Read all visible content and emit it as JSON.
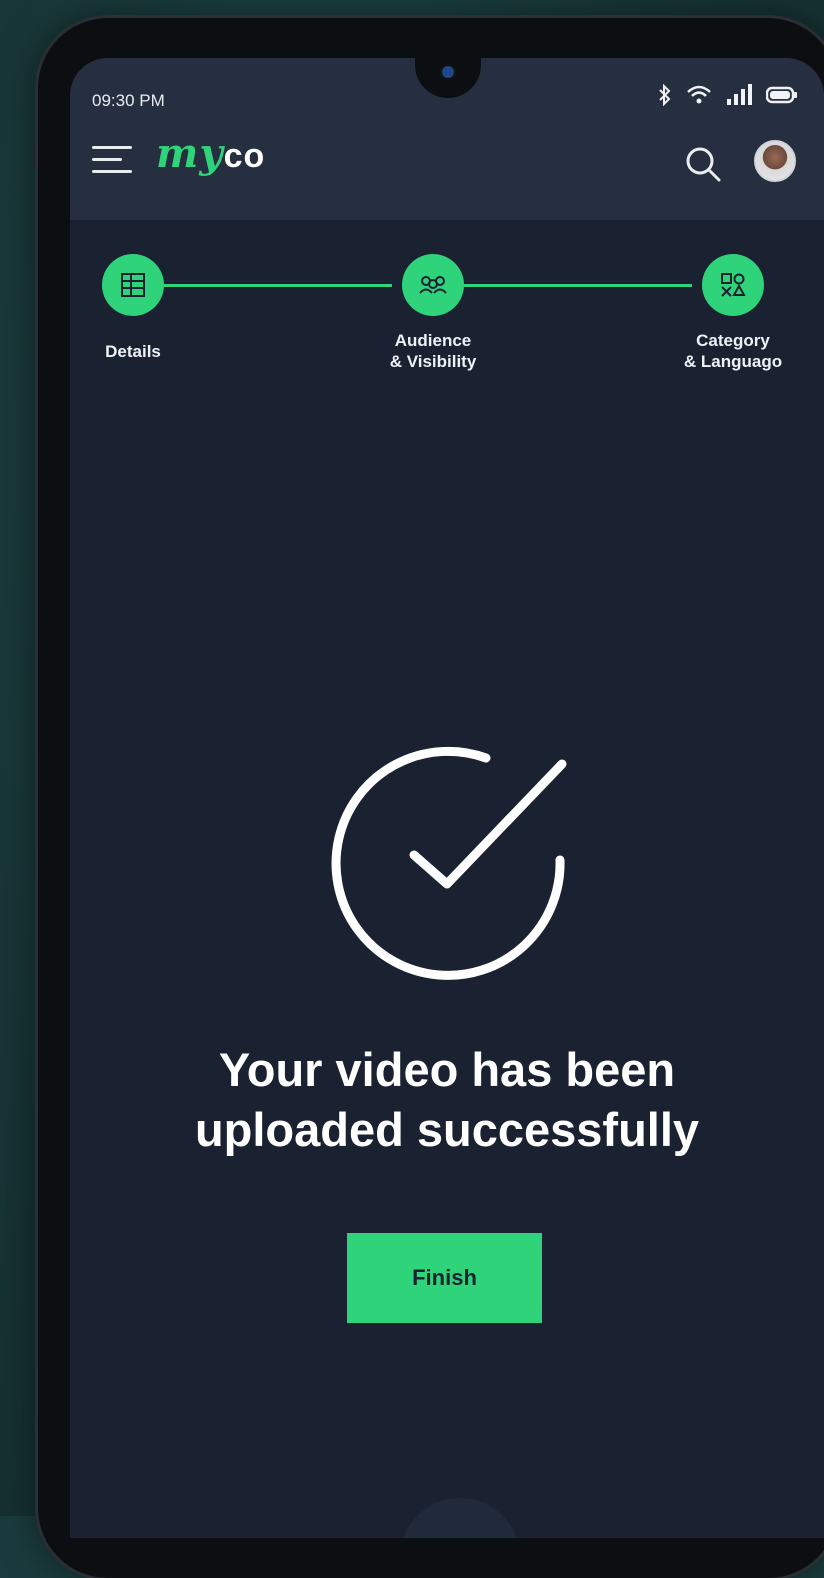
{
  "status_bar": {
    "time": "09:30 PM",
    "icons": [
      "bluetooth-icon",
      "wifi-icon",
      "signal-icon",
      "battery-icon"
    ]
  },
  "app_bar": {
    "logo_script": "my",
    "logo_mark": "co",
    "menu_icon": "hamburger-menu-icon",
    "search_icon": "search-icon",
    "avatar": "user-avatar"
  },
  "stepper": {
    "steps": [
      {
        "label_line1": "Details",
        "label_line2": "",
        "icon": "details-icon"
      },
      {
        "label_line1": "Audience",
        "label_line2": "& Visibility",
        "icon": "audience-icon"
      },
      {
        "label_line1": "Category",
        "label_line2": "& Languago",
        "icon": "category-icon"
      }
    ]
  },
  "success": {
    "icon": "check-circle-icon",
    "title_line1": "Your video has been",
    "title_line2": "uploaded successfully",
    "finish_label": "Finish"
  },
  "colors": {
    "accent": "#2fd37a",
    "screen_bg": "#1a2232",
    "topbar_bg": "#262f3f",
    "background": "#1a3b3d"
  }
}
